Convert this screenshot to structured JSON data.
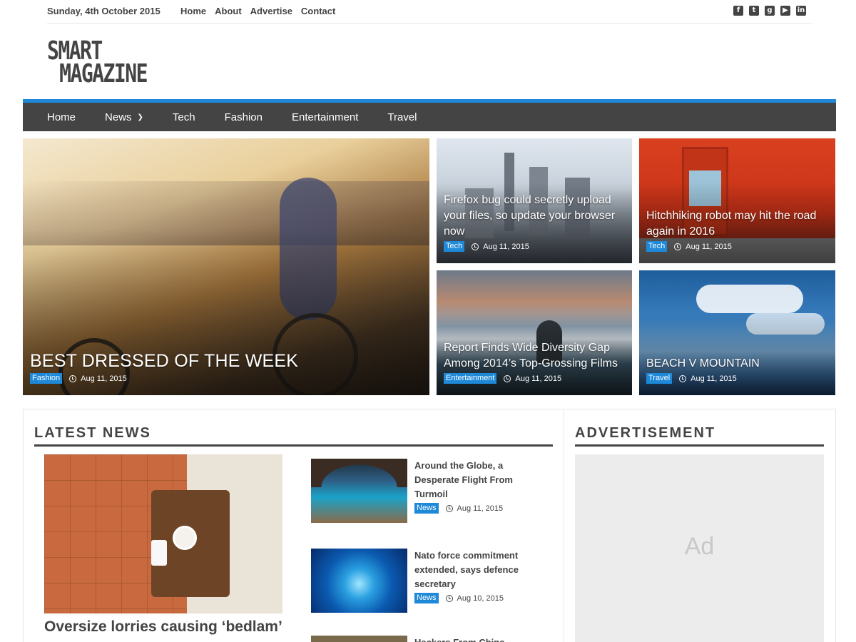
{
  "topbar": {
    "date": "Sunday, 4th October 2015",
    "links": [
      "Home",
      "About",
      "Advertise",
      "Contact"
    ],
    "social_icons": [
      "facebook-icon",
      "twitter-icon",
      "google-plus-icon",
      "youtube-icon",
      "linkedin-icon"
    ]
  },
  "logo": {
    "line1": "SMART",
    "line2": "MAGAZINE"
  },
  "nav": {
    "items": [
      "Home",
      "News",
      "Tech",
      "Fashion",
      "Entertainment",
      "Travel"
    ],
    "accent": "#1e88d9",
    "bg": "#444444"
  },
  "featured": [
    {
      "title": "BEST DRESSED OF THE WEEK",
      "category": "Fashion",
      "date": "Aug 11, 2015"
    },
    {
      "title": "Firefox bug could secretly upload your files, so update your browser now",
      "category": "Tech",
      "date": "Aug 11, 2015"
    },
    {
      "title": "Hitchhiking robot may hit the road again in 2016",
      "category": "Tech",
      "date": "Aug 11, 2015"
    },
    {
      "title": "Report Finds Wide Diversity Gap Among 2014’s Top-Grossing Films",
      "category": "Entertainment",
      "date": "Aug 11, 2015"
    },
    {
      "title": "BEACH V MOUNTAIN",
      "category": "Travel",
      "date": "Aug 11, 2015"
    }
  ],
  "latest": {
    "heading": "LATEST NEWS",
    "lead_title": "Oversize lorries causing ‘bedlam’",
    "items": [
      {
        "title": "Around the Globe, a Desperate Flight From Turmoil",
        "category": "News",
        "date": "Aug 11, 2015"
      },
      {
        "title": "Nato force commitment extended, says defence secretary",
        "category": "News",
        "date": "Aug 10, 2015"
      },
      {
        "title": "Hackers From China",
        "category": "",
        "date": ""
      }
    ]
  },
  "sidebar": {
    "heading": "ADVERTISEMENT",
    "ad_label": "Ad"
  }
}
